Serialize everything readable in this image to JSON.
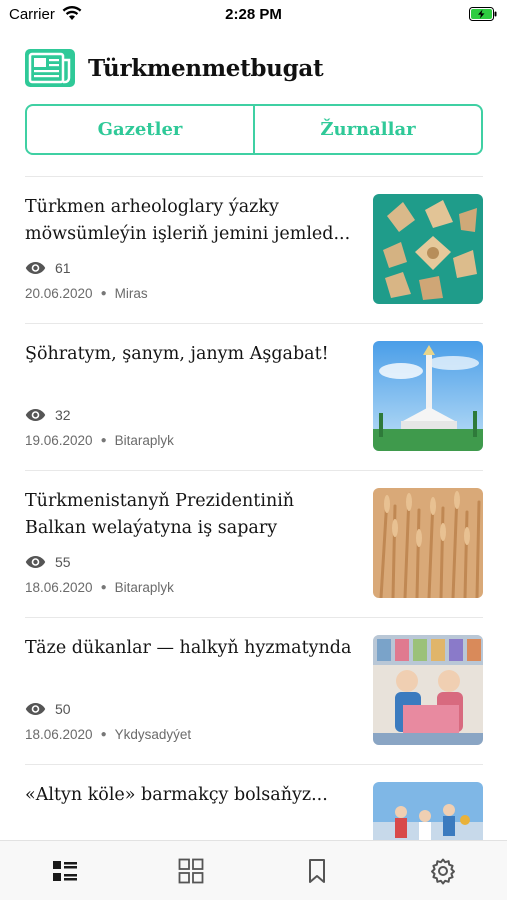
{
  "status_bar": {
    "carrier": "Carrier",
    "time": "2:28 PM"
  },
  "header": {
    "title": "Türkmenmetbugat",
    "logo_icon": "newspaper-icon"
  },
  "segments": [
    {
      "label": "Gazetler"
    },
    {
      "label": "Žurnallar"
    }
  ],
  "colors": {
    "accent": "#2fc998",
    "border": "#3fd0a3"
  },
  "articles": [
    {
      "title": "Türkmen arheologlary ýazky möwsümleýin işleriň jemini jemled...",
      "views": "61",
      "date": "20.06.2020",
      "category": "Miras"
    },
    {
      "title": "Şöhratym, şanym, janym Aşgabat!",
      "views": "32",
      "date": "19.06.2020",
      "category": "Bitaraplyk"
    },
    {
      "title": "Türkmenistanyň Prezidentiniň Balkan welaýatyna iş sapary",
      "views": "55",
      "date": "18.06.2020",
      "category": "Bitaraplyk"
    },
    {
      "title": "Täze dükanlar — halkyň hyzmatynda",
      "views": "50",
      "date": "18.06.2020",
      "category": "Ykdysadyýet"
    },
    {
      "title": "«Altyn köle» barmakçy bolsaňyz...",
      "views": "",
      "date": "",
      "category": ""
    }
  ],
  "tabs": [
    {
      "name": "list-icon"
    },
    {
      "name": "grid-icon"
    },
    {
      "name": "bookmark-icon"
    },
    {
      "name": "settings-icon"
    }
  ]
}
